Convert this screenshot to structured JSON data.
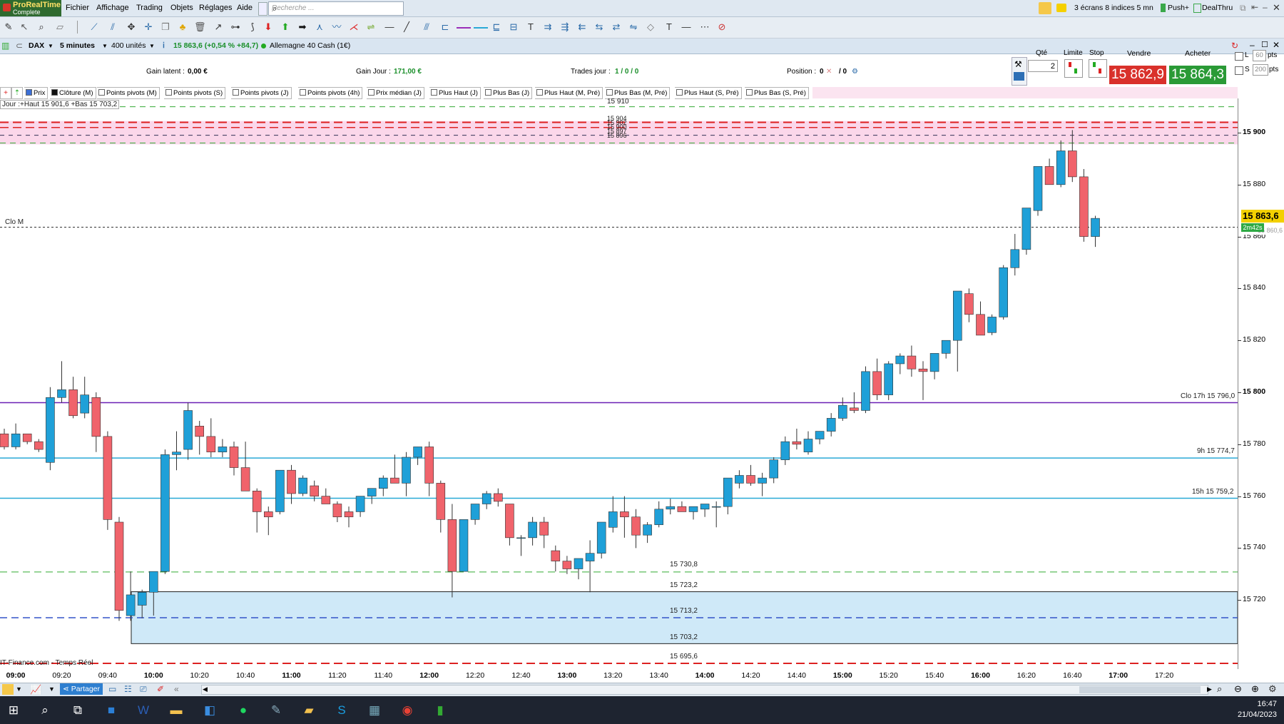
{
  "app": {
    "brand_line1": "ProRealTime",
    "brand_line2": "Complete"
  },
  "menu": [
    "Fichier",
    "Affichage",
    "Trading",
    "Objets",
    "Réglages",
    "Aide"
  ],
  "search": {
    "placeholder": "Recherche ..."
  },
  "top_right": {
    "layout": "3 écrans 8 indices 5 mn",
    "push": "Push+",
    "dealthru": "DealThru"
  },
  "chart_header": {
    "instrument": "DAX",
    "timeframe": "5 minutes",
    "units": "400 unités",
    "price_change": "15 863,6 (+0,54 % +84,7)",
    "market": "Allemagne 40 Cash (1€)"
  },
  "info": {
    "gain_latent_label": "Gain latent :",
    "gain_latent_value": "0,00 €",
    "gain_jour_label": "Gain Jour :",
    "gain_jour_value": "171,00 €",
    "trades_label": "Trades jour :",
    "trades_value": "1 / 0 / 0",
    "position_label": "Position :",
    "position_value": "0",
    "position_value2": "/ 0"
  },
  "order_panel": {
    "qty_label": "Qté",
    "qty_value": "2",
    "limit_label": "Limite",
    "stop_label": "Stop",
    "sell_label": "Vendre",
    "buy_label": "Acheter",
    "sell_price": "15 862,9",
    "buy_price": "15 864,3",
    "l_label": "L",
    "l_value": "60",
    "s_label": "S",
    "s_value": "200",
    "pts": "pts"
  },
  "indicator_tabs": [
    "Prix",
    "Clôture (M)",
    "Points pivots (M)",
    "Points pivots (S)",
    "Points pivots (J)",
    "Points pivots (4h)",
    "Prix médian (J)",
    "Plus Haut (J)",
    "Plus Bas (J)",
    "Plus Haut (M, Pré)",
    "Plus Bas (M, Pré)",
    "Plus Haut (S, Pré)",
    "Plus Bas (S, Pré)"
  ],
  "chart_labels": {
    "jour": "Jour :+Haut 15 901,6 +Bas 15 703,2",
    "clo_m": "Clo M",
    "source": "IT-Finance.com - Temps Réel",
    "lvl_15910": "15 910",
    "lvl_15904": "15 904",
    "lvl_15902": "15 902",
    "lvl_15900": "15 900",
    "lvl_15897": "15 897",
    "lvl_15896": "15 896",
    "clo17": "Clo 17h 15 796,0",
    "h9": "9h 15 774,7",
    "h15": "15h 15 759,2",
    "l15730": "15 730,8",
    "l15723": "15 723,2",
    "l15713": "15 713,2",
    "l15703": "15 703,2",
    "l15695": "15 695,6",
    "price_tag": "15 863,6",
    "timer_tag": "2m42s",
    "hidden_tag": "15 860,6"
  },
  "y_ticks": [
    "15 900",
    "15 880",
    "15 860",
    "15 840",
    "15 820",
    "15 800",
    "15 780",
    "15 760",
    "15 740",
    "15 720"
  ],
  "x_ticks": [
    {
      "t": "09:00",
      "b": true
    },
    {
      "t": "09:20",
      "b": false
    },
    {
      "t": "09:40",
      "b": false
    },
    {
      "t": "10:00",
      "b": true
    },
    {
      "t": "10:20",
      "b": false
    },
    {
      "t": "10:40",
      "b": false
    },
    {
      "t": "11:00",
      "b": true
    },
    {
      "t": "11:20",
      "b": false
    },
    {
      "t": "11:40",
      "b": false
    },
    {
      "t": "12:00",
      "b": true
    },
    {
      "t": "12:20",
      "b": false
    },
    {
      "t": "12:40",
      "b": false
    },
    {
      "t": "13:00",
      "b": true
    },
    {
      "t": "13:20",
      "b": false
    },
    {
      "t": "13:40",
      "b": false
    },
    {
      "t": "14:00",
      "b": true
    },
    {
      "t": "14:20",
      "b": false
    },
    {
      "t": "14:40",
      "b": false
    },
    {
      "t": "15:00",
      "b": true
    },
    {
      "t": "15:20",
      "b": false
    },
    {
      "t": "15:40",
      "b": false
    },
    {
      "t": "16:00",
      "b": true
    },
    {
      "t": "16:20",
      "b": false
    },
    {
      "t": "16:40",
      "b": false
    },
    {
      "t": "17:00",
      "b": true
    },
    {
      "t": "17:20",
      "b": false
    }
  ],
  "bottom": {
    "share": "Partager"
  },
  "taskbar": {
    "time": "16:47",
    "date": "21/04/2023"
  },
  "colors": {
    "up": "#1fa0d8",
    "down": "#f0636b",
    "pivot_red": "#d22",
    "pivot_green": "#3a3",
    "purple": "#6a1fb5",
    "cyan": "#29a9d6"
  },
  "chart_data": {
    "type": "candlestick",
    "ylim": [
      15690,
      15925
    ],
    "start": "08:55",
    "interval_min": 5,
    "candles": [
      [
        15784,
        15786,
        15778,
        15779
      ],
      [
        15779,
        15788,
        15778,
        15784
      ],
      [
        15784,
        15784,
        15780,
        15781
      ],
      [
        15781,
        15782,
        15777,
        15778
      ],
      [
        15773,
        15802,
        15770,
        15798
      ],
      [
        15798,
        15812,
        15796,
        15801
      ],
      [
        15801,
        15806,
        15790,
        15791
      ],
      [
        15792,
        15806,
        15790,
        15799
      ],
      [
        15798,
        15800,
        15777,
        15783
      ],
      [
        15783,
        15785,
        15747,
        15751
      ],
      [
        15750,
        15752,
        15712,
        15716
      ],
      [
        15714,
        15731,
        15712,
        15722
      ],
      [
        15718,
        15724,
        15713,
        15723
      ],
      [
        15723,
        15730,
        15714,
        15731
      ],
      [
        15731,
        15778,
        15730,
        15776
      ],
      [
        15776,
        15785,
        15770,
        15777
      ],
      [
        15778,
        15796,
        15774,
        15793
      ],
      [
        15787,
        15789,
        15776,
        15783
      ],
      [
        15783,
        15790,
        15775,
        15777
      ],
      [
        15777,
        15782,
        15775,
        15779
      ],
      [
        15779,
        15781,
        15768,
        15771
      ],
      [
        15771,
        15781,
        15765,
        15762
      ],
      [
        15762,
        15763,
        15746,
        15754
      ],
      [
        15754,
        15756,
        15745,
        15752
      ],
      [
        15754,
        15770,
        15753,
        15770
      ],
      [
        15770,
        15772,
        15757,
        15761
      ],
      [
        15761,
        15768,
        15760,
        15767
      ],
      [
        15764,
        15766,
        15758,
        15760
      ],
      [
        15760,
        15763,
        15757,
        15757
      ],
      [
        15757,
        15758,
        15750,
        15752
      ],
      [
        15754,
        15756,
        15748,
        15752
      ],
      [
        15754,
        15760,
        15752,
        15760
      ],
      [
        15760,
        15763,
        15757,
        15763
      ],
      [
        15763,
        15768,
        15760,
        15767
      ],
      [
        15767,
        15776,
        15765,
        15765
      ],
      [
        15765,
        15777,
        15760,
        15775
      ],
      [
        15775,
        15779,
        15772,
        15779
      ],
      [
        15779,
        15781,
        15760,
        15765
      ],
      [
        15765,
        15766,
        15746,
        15751
      ],
      [
        15751,
        15757,
        15721,
        15731
      ],
      [
        15731,
        15750,
        15731,
        15751
      ],
      [
        15751,
        15757,
        15749,
        15757
      ],
      [
        15757,
        15762,
        15755,
        15761
      ],
      [
        15761,
        15763,
        15756,
        15758
      ],
      [
        15757,
        15757,
        15741,
        15744
      ],
      [
        15744,
        15745,
        15737,
        15744
      ],
      [
        15744,
        15752,
        15741,
        15750
      ],
      [
        15750,
        15752,
        15740,
        15745
      ],
      [
        15739,
        15741,
        15731,
        15735
      ],
      [
        15735,
        15737,
        15730,
        15732
      ],
      [
        15732,
        15736,
        15728,
        15736
      ],
      [
        15735,
        15743,
        15723,
        15738
      ],
      [
        15738,
        15747,
        15736,
        15750
      ],
      [
        15748,
        15760,
        15746,
        15754
      ],
      [
        15754,
        15760,
        15744,
        15752
      ],
      [
        15752,
        15755,
        15740,
        15745
      ],
      [
        15745,
        15750,
        15742,
        15749
      ],
      [
        15749,
        15758,
        15748,
        15755
      ],
      [
        15755,
        15759,
        15753,
        15756
      ],
      [
        15756,
        15758,
        15754,
        15754
      ],
      [
        15754,
        15756,
        15751,
        15756
      ],
      [
        15755,
        15757,
        15752,
        15757
      ],
      [
        15756,
        15758,
        15748,
        15756
      ],
      [
        15756,
        15767,
        15753,
        15767
      ],
      [
        15765,
        15770,
        15763,
        15768
      ],
      [
        15768,
        15772,
        15764,
        15765
      ],
      [
        15765,
        15769,
        15760,
        15767
      ],
      [
        15767,
        15775,
        15765,
        15774
      ],
      [
        15774,
        15783,
        15772,
        15781
      ],
      [
        15781,
        15786,
        15778,
        15780
      ],
      [
        15777,
        15785,
        15776,
        15782
      ],
      [
        15782,
        15785,
        15780,
        15785
      ],
      [
        15785,
        15792,
        15783,
        15790
      ],
      [
        15790,
        15798,
        15789,
        15795
      ],
      [
        15794,
        15800,
        15792,
        15793
      ],
      [
        15793,
        15810,
        15792,
        15808
      ],
      [
        15808,
        15813,
        15797,
        15799
      ],
      [
        15799,
        15812,
        15797,
        15811
      ],
      [
        15811,
        15815,
        15807,
        15814
      ],
      [
        15814,
        15818,
        15806,
        15809
      ],
      [
        15809,
        15812,
        15797,
        15808
      ],
      [
        15808,
        15814,
        15805,
        15815
      ],
      [
        15815,
        15820,
        15813,
        15820
      ],
      [
        15820,
        15825,
        15808,
        15839
      ],
      [
        15838,
        15840,
        15827,
        15830
      ],
      [
        15830,
        15835,
        15822,
        15822
      ],
      [
        15823,
        15830,
        15822,
        15829
      ],
      [
        15829,
        15849,
        15828,
        15848
      ],
      [
        15848,
        15861,
        15845,
        15855
      ],
      [
        15855,
        15871,
        15853,
        15871
      ],
      [
        15870,
        15887,
        15868,
        15887
      ],
      [
        15887,
        15890,
        15880,
        15880
      ],
      [
        15880,
        15897,
        15879,
        15893
      ],
      [
        15893,
        15901,
        15881,
        15883
      ],
      [
        15883,
        15886,
        15858,
        15860
      ],
      [
        15860,
        15868,
        15856,
        15867
      ]
    ]
  }
}
